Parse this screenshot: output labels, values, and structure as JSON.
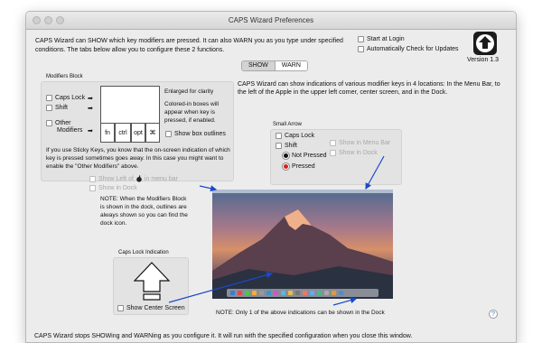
{
  "window": {
    "title": "CAPS Wizard Preferences"
  },
  "intro": "CAPS Wizard can SHOW which key modifiers are pressed.  It can also WARN you as you type under specified conditions.  The tabs below allow you to configure these 2 functions.",
  "top_right": {
    "start_at_login": "Start at Login",
    "auto_update": "Automatically Check for Updates",
    "version": "Version 1.3"
  },
  "tabs": [
    "SHOW",
    "WARN"
  ],
  "modifiers_block": {
    "title": "Modifiers Block",
    "caps_lock": "Caps Lock",
    "shift": "Shift",
    "other_line1": "Other",
    "other_line2": "Modifiers",
    "arrow": "➡",
    "keys": [
      "fn",
      "ctrl",
      "opt",
      "⌘"
    ],
    "enlarged": "Enlarged for clarity",
    "colored_note": "Colored-in boxes will appear when key is pressed, if enabled.",
    "show_box_outlines": "Show box outlines",
    "sticky_note": "If you use Sticky Keys, you know that the on-screen indication of which key is pressed sometimes goes away.  In this case you might want to enable the \"Other Modifiers\" above.",
    "show_left_of": "Show Left of",
    "in_menu_bar": "in menu bar",
    "show_in_dock": "Show in Dock",
    "dock_note": "NOTE: When the Modifiers Block is shown in the dock, outlines are always shown so you can find the dock icon."
  },
  "description": "CAPS Wizard can show indications of various modifier keys in 4 locations: In the Menu Bar, to the left of the Apple in the upper left corner, center screen, and in the Dock.",
  "small_arrow": {
    "title": "Small Arrow",
    "caps_lock": "Caps Lock",
    "shift": "Shift",
    "not_pressed": "Not Pressed",
    "pressed": "Pressed",
    "show_in_menu_bar": "Show in Menu Bar",
    "show_in_dock": "Show in Dock"
  },
  "caps_lock_indication": {
    "title": "Caps Lock Indication",
    "show_center_screen": "Show Center Screen"
  },
  "bottom_note": "NOTE: Only 1 of the above indications can be shown in the Dock",
  "help": "?",
  "footer": "CAPS Wizard stops SHOWing and WARNing as you configure it.  It will run with the specified configuration when you close this window."
}
